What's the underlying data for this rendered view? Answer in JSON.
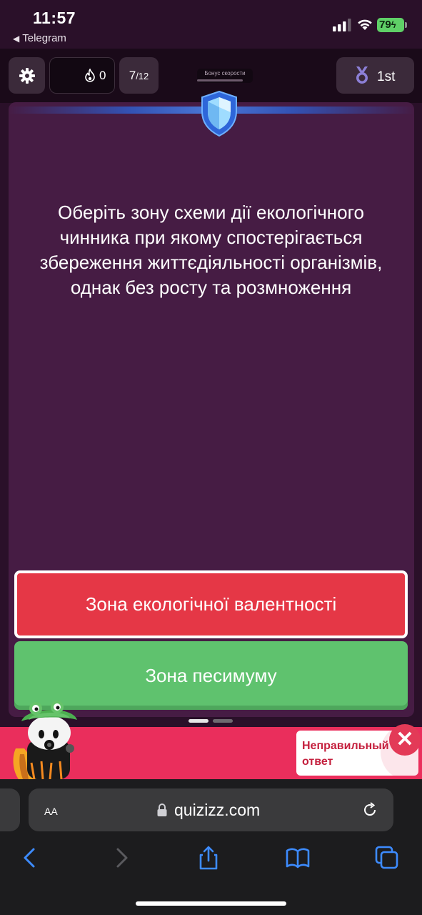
{
  "status_bar": {
    "time": "11:57",
    "back_app": "Telegram",
    "battery": "79"
  },
  "game_header": {
    "streak_count": "0",
    "progress_current": "7",
    "progress_total": "/12",
    "speed_bonus_label": "Бонус скорости",
    "rank": "1st"
  },
  "question": {
    "text": "Оберіть зону схеми дії екологічного чинника при якому спостерігається збереження життєдіяльності організмів, однак без росту та розмноження"
  },
  "options": [
    {
      "label": "Зона екологічної валентності",
      "state": "selected-wrong",
      "color": "#e53746"
    },
    {
      "label": "Зона песимуму",
      "state": "correct",
      "color": "#5fc26e"
    }
  ],
  "pager": {
    "pages": 2,
    "active": 1
  },
  "feedback": {
    "text": "Неправильный ответ",
    "banner_color": "#ea2e5c"
  },
  "browser": {
    "aa_label": "AA",
    "url": "quizizz.com"
  },
  "colors": {
    "card_bg": "#461c44",
    "page_bg": "#2a1029"
  }
}
